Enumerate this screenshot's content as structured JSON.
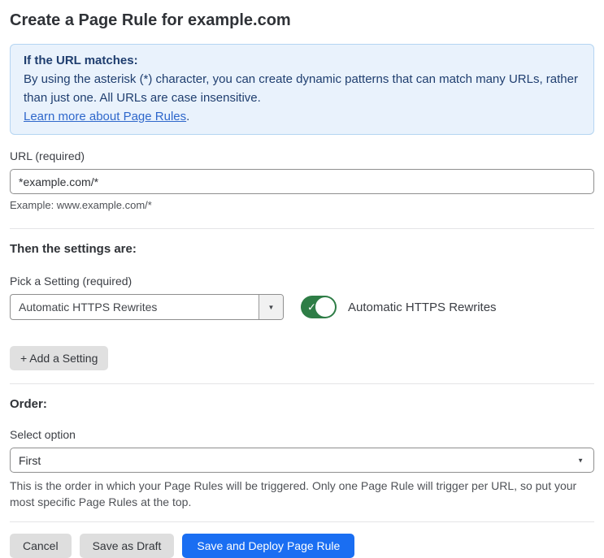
{
  "page": {
    "title": "Create a Page Rule for example.com"
  },
  "info_box": {
    "heading": "If the URL matches:",
    "body": "By using the asterisk (*) character, you can create dynamic patterns that can match many URLs, rather than just one. All URLs are case insensitive.",
    "link_text": "Learn more about Page Rules",
    "link_suffix": "."
  },
  "url_section": {
    "label": "URL (required)",
    "value": "*example.com/*",
    "example": "Example: www.example.com/*"
  },
  "settings_section": {
    "heading": "Then the settings are:",
    "picker_label": "Pick a Setting (required)",
    "selected_setting": "Automatic HTTPS Rewrites",
    "toggle_label": "Automatic HTTPS Rewrites",
    "toggle_state": "on",
    "add_button_label": "+ Add a Setting"
  },
  "order_section": {
    "heading": "Order:",
    "label": "Select option",
    "selected_option": "First",
    "help_text": "This is the order in which your Page Rules will be triggered. Only one Page Rule will trigger per URL, so put your most specific Page Rules at the top."
  },
  "footer": {
    "cancel_label": "Cancel",
    "save_draft_label": "Save as Draft",
    "deploy_label": "Save and Deploy Page Rule"
  },
  "icons": {
    "dropdown_arrow": "▼",
    "check": "✓"
  },
  "colors": {
    "accent_blue": "#1a6ef2",
    "info_bg": "#e9f2fc",
    "info_border": "#b5d5f2",
    "info_text": "#1f3e6f",
    "link_blue": "#2e67cb",
    "toggle_green": "#2e7d46",
    "button_gray": "#dedede"
  }
}
